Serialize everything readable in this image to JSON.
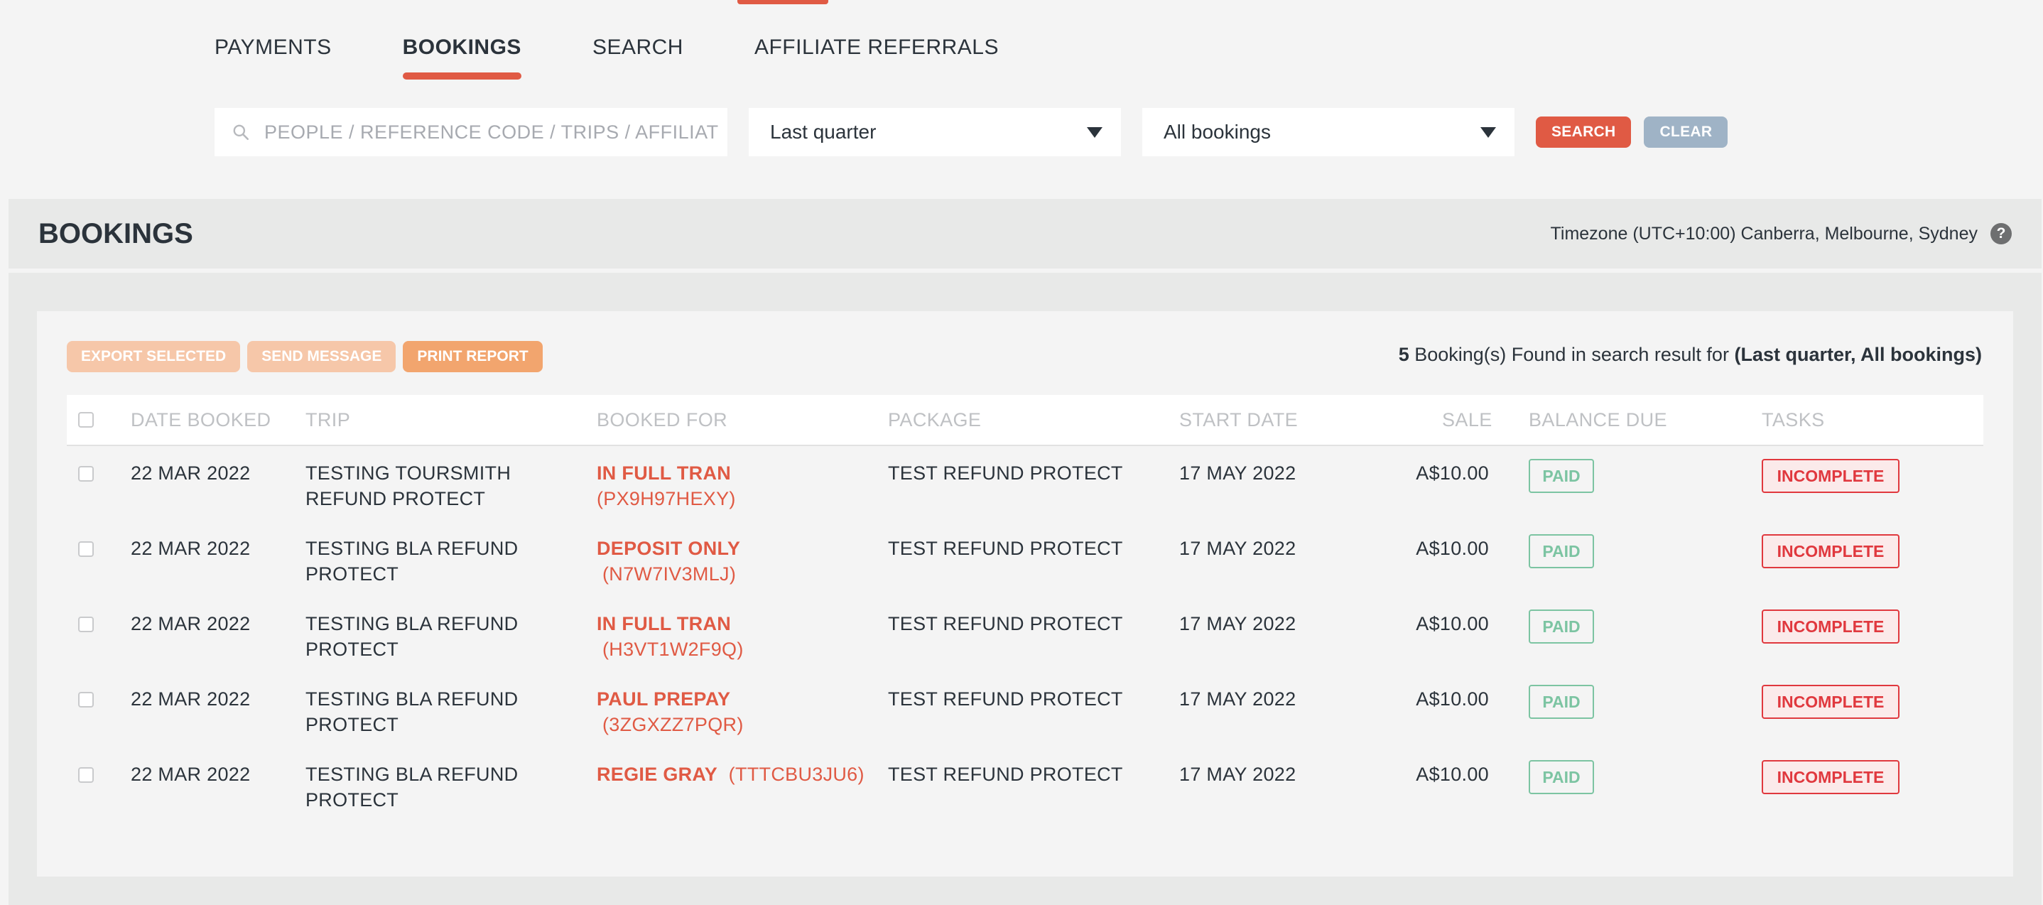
{
  "nav": {
    "tabs": [
      {
        "label": "PAYMENTS"
      },
      {
        "label": "BOOKINGS"
      },
      {
        "label": "SEARCH"
      },
      {
        "label": "AFFILIATE REFERRALS"
      }
    ]
  },
  "filters": {
    "search_placeholder": "PEOPLE / REFERENCE CODE / TRIPS / AFFILIATE",
    "period": "Last quarter",
    "type": "All bookings",
    "search_label": "SEARCH",
    "clear_label": "CLEAR"
  },
  "header": {
    "title": "BOOKINGS",
    "timezone": "Timezone (UTC+10:00) Canberra, Melbourne, Sydney",
    "help": "?"
  },
  "actions": {
    "export": "EXPORT SELECTED",
    "message": "SEND MESSAGE",
    "print": "PRINT REPORT"
  },
  "results": {
    "count": "5",
    "text": " Booking(s) Found in search result for ",
    "criteria": "(Last quarter, All bookings)"
  },
  "table": {
    "columns": {
      "date_booked": "DATE BOOKED",
      "trip": "TRIP",
      "booked_for": "BOOKED FOR",
      "package": "PACKAGE",
      "start_date": "START DATE",
      "sale": "SALE",
      "balance_due": "BALANCE DUE",
      "tasks": "TASKS"
    },
    "rows": [
      {
        "date": "22 MAR 2022",
        "trip_1": "TESTING TOURSMITH",
        "trip_2": "REFUND PROTECT",
        "name": "IN FULL TRAN",
        "code_inline": "(PX9H97HEXY)",
        "code_below": "",
        "package": "TEST REFUND PROTECT",
        "start": "17 MAY 2022",
        "sale": "A$10.00",
        "balance": "PAID",
        "task": "INCOMPLETE"
      },
      {
        "date": "22 MAR 2022",
        "trip_1": "TESTING BLA REFUND",
        "trip_2": "PROTECT",
        "name": "DEPOSIT ONLY",
        "code_inline": "",
        "code_below": "(N7W7IV3MLJ)",
        "package": "TEST REFUND PROTECT",
        "start": "17 MAY 2022",
        "sale": "A$10.00",
        "balance": "PAID",
        "task": "INCOMPLETE"
      },
      {
        "date": "22 MAR 2022",
        "trip_1": "TESTING BLA REFUND",
        "trip_2": "PROTECT",
        "name": "IN FULL TRAN",
        "code_inline": "",
        "code_below": "(H3VT1W2F9Q)",
        "package": "TEST REFUND PROTECT",
        "start": "17 MAY 2022",
        "sale": "A$10.00",
        "balance": "PAID",
        "task": "INCOMPLETE"
      },
      {
        "date": "22 MAR 2022",
        "trip_1": "TESTING BLA REFUND",
        "trip_2": "PROTECT",
        "name": "PAUL PREPAY",
        "code_inline": "",
        "code_below": "(3ZGXZZ7PQR)",
        "package": "TEST REFUND PROTECT",
        "start": "17 MAY 2022",
        "sale": "A$10.00",
        "balance": "PAID",
        "task": "INCOMPLETE"
      },
      {
        "date": "22 MAR 2022",
        "trip_1": "TESTING BLA REFUND",
        "trip_2": "PROTECT",
        "name": "REGIE GRAY",
        "code_inline": "(TTTCBU3JU6)",
        "code_below": "",
        "package": "TEST REFUND PROTECT",
        "start": "17 MAY 2022",
        "sale": "A$10.00",
        "balance": "PAID",
        "task": "INCOMPLETE"
      }
    ]
  },
  "colors": {
    "accent": "#e05a44",
    "paid": "#7cc4a2",
    "incomplete": "#e0383e"
  }
}
